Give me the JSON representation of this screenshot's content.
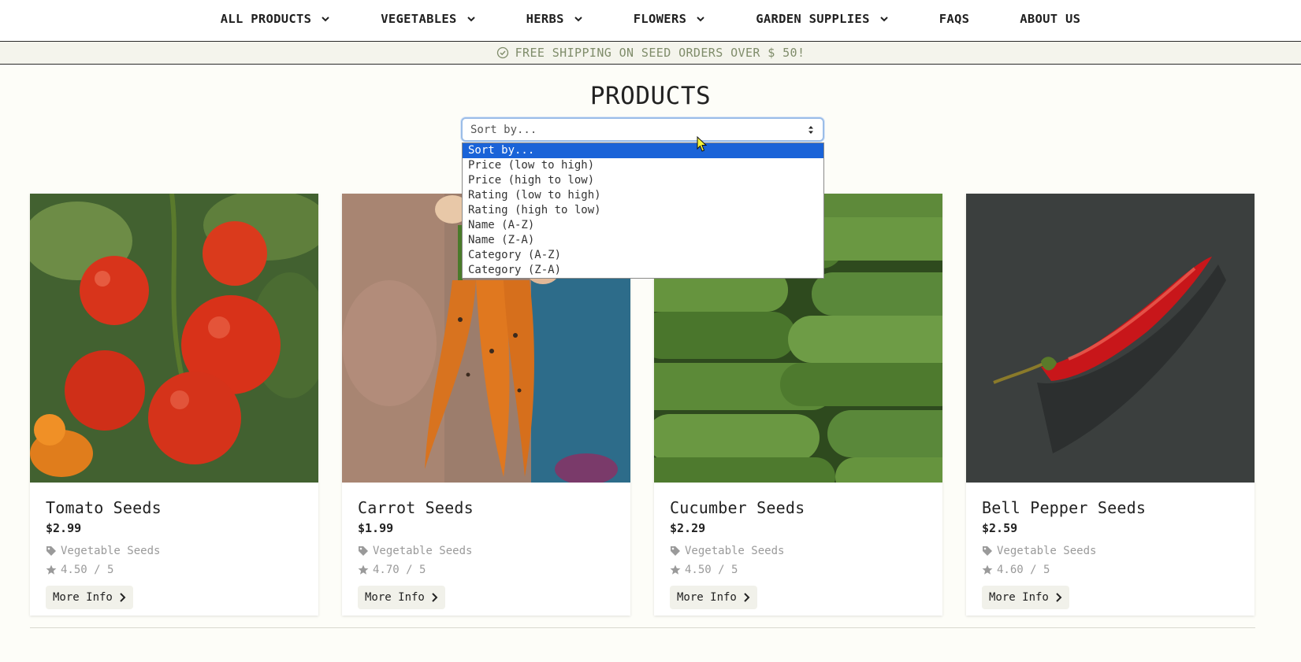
{
  "nav": {
    "items": [
      {
        "label": "ALL PRODUCTS",
        "has_dropdown": true
      },
      {
        "label": "VEGETABLES",
        "has_dropdown": true
      },
      {
        "label": "HERBS",
        "has_dropdown": true
      },
      {
        "label": "FLOWERS",
        "has_dropdown": true
      },
      {
        "label": "GARDEN SUPPLIES",
        "has_dropdown": true
      },
      {
        "label": "FAQS",
        "has_dropdown": false
      },
      {
        "label": "ABOUT US",
        "has_dropdown": false
      }
    ]
  },
  "banner": {
    "text": "FREE SHIPPING ON SEED ORDERS OVER $ 50!",
    "icon": "check-circle-icon"
  },
  "page": {
    "title": "PRODUCTS"
  },
  "sort": {
    "selected": "Sort by...",
    "options": [
      "Sort by...",
      "Price (low to high)",
      "Price (high to low)",
      "Rating (low to high)",
      "Rating (high to low)",
      "Name (A-Z)",
      "Name (Z-A)",
      "Category (A-Z)",
      "Category (Z-A)"
    ],
    "highlighted_index": 0
  },
  "products": [
    {
      "name": "Tomato Seeds",
      "price": "$2.99",
      "category": "Vegetable Seeds",
      "rating": "4.50 / 5",
      "button": "More Info"
    },
    {
      "name": "Carrot Seeds",
      "price": "$1.99",
      "category": "Vegetable Seeds",
      "rating": "4.70 / 5",
      "button": "More Info"
    },
    {
      "name": "Cucumber Seeds",
      "price": "$2.29",
      "category": "Vegetable Seeds",
      "rating": "4.50 / 5",
      "button": "More Info"
    },
    {
      "name": "Bell Pepper Seeds",
      "price": "$2.59",
      "category": "Vegetable Seeds",
      "rating": "4.60 / 5",
      "button": "More Info"
    }
  ],
  "colors": {
    "background": "#fdfdf8",
    "banner_text": "#7f8c6a",
    "selected_option": "#1a63d8",
    "select_border": "#9bbde8"
  }
}
